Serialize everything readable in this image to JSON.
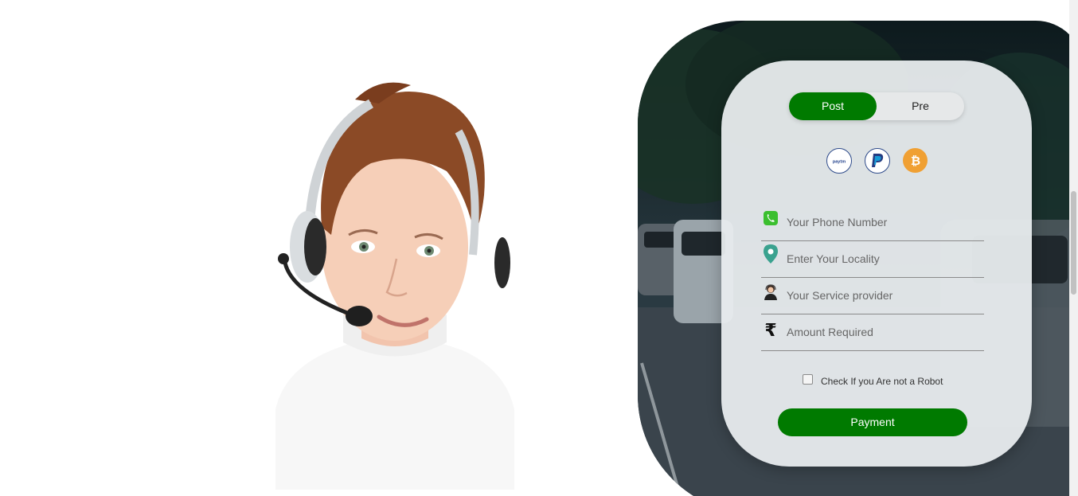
{
  "form": {
    "toggle": {
      "post_label": "Post",
      "pre_label": "Pre",
      "selected": "Post"
    },
    "payment_icons": [
      "paytm-icon",
      "paypal-icon",
      "bitcoin-icon"
    ],
    "fields": {
      "phone_placeholder": "Your Phone Number",
      "locality_placeholder": "Enter Your Locality",
      "provider_placeholder": "Your Service provider",
      "amount_placeholder": "Amount Required"
    },
    "robot_check_label": "Check If you Are not a Robot",
    "robot_checked": false,
    "submit_label": "Payment"
  },
  "colors": {
    "accent": "#007a00",
    "card": "#e8ecee",
    "bitcoin": "#f0a033",
    "paypal": "#2d4a8a"
  }
}
